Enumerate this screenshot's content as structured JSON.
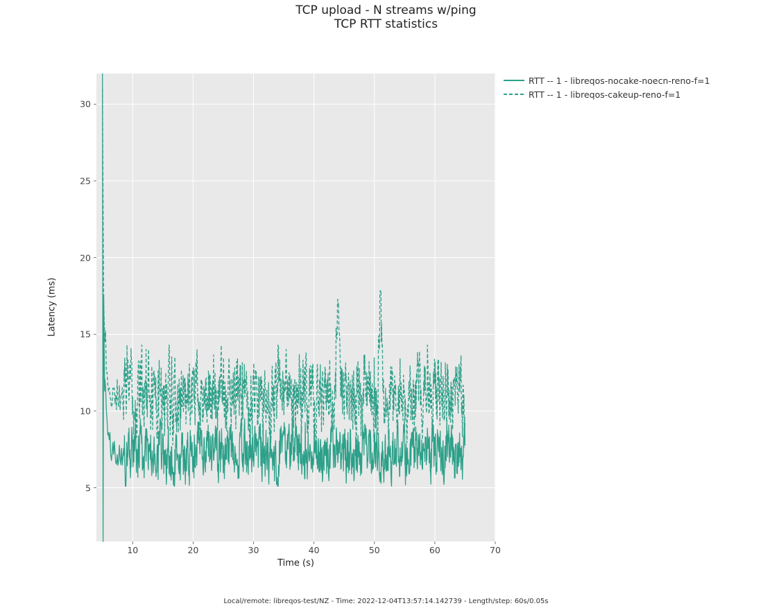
{
  "chart_data": {
    "type": "line",
    "title_line1": "TCP upload - N streams w/ping",
    "title_line2": "TCP RTT statistics",
    "xlabel": "Time (s)",
    "ylabel": "Latency (ms)",
    "xlim": [
      4,
      70
    ],
    "ylim": [
      1.5,
      32
    ],
    "footer": "Local/remote: libreqos-test/NZ - Time: 2022-12-04T13:57:14.142739 - Length/step: 60s/0.05s",
    "x_ticks": [
      10,
      20,
      30,
      40,
      50,
      60,
      70
    ],
    "y_ticks": [
      5,
      10,
      15,
      20,
      25,
      30
    ],
    "legend_position": "upper right outside",
    "color": "#2ca089",
    "series": [
      {
        "name": "RTT -- 1 - libreqos-nocake-noecn-reno-f=1",
        "style": "solid",
        "approx_mean": 7.3,
        "approx_min_after_start": 5.6,
        "approx_max_after_start": 9.2,
        "initial_spike_at_t": 5.0,
        "initial_spike_value": 32.0,
        "initial_dip_value": 1.5,
        "oscillation_amplitude": 1.2,
        "x_range": [
          5,
          65
        ],
        "note": "dense noisy time-series ~1200 points; Reno without cake, no ECN; baseline lower band"
      },
      {
        "name": "RTT -- 1 - libreqos-cakeup-reno-f=1",
        "style": "dashed",
        "approx_mean": 11.0,
        "approx_min_after_start": 8.3,
        "approx_max_after_start": 14.0,
        "initial_spike_at_t": 5.0,
        "initial_spike_value": 31.0,
        "oscillation_amplitude": 1.6,
        "x_range": [
          5,
          65
        ],
        "spikes": [
          {
            "t": 44,
            "v": 17.3
          },
          {
            "t": 51,
            "v": 17.9
          }
        ],
        "note": "dense noisy time-series ~1200 points; Reno with cake up; baseline higher band"
      }
    ]
  }
}
